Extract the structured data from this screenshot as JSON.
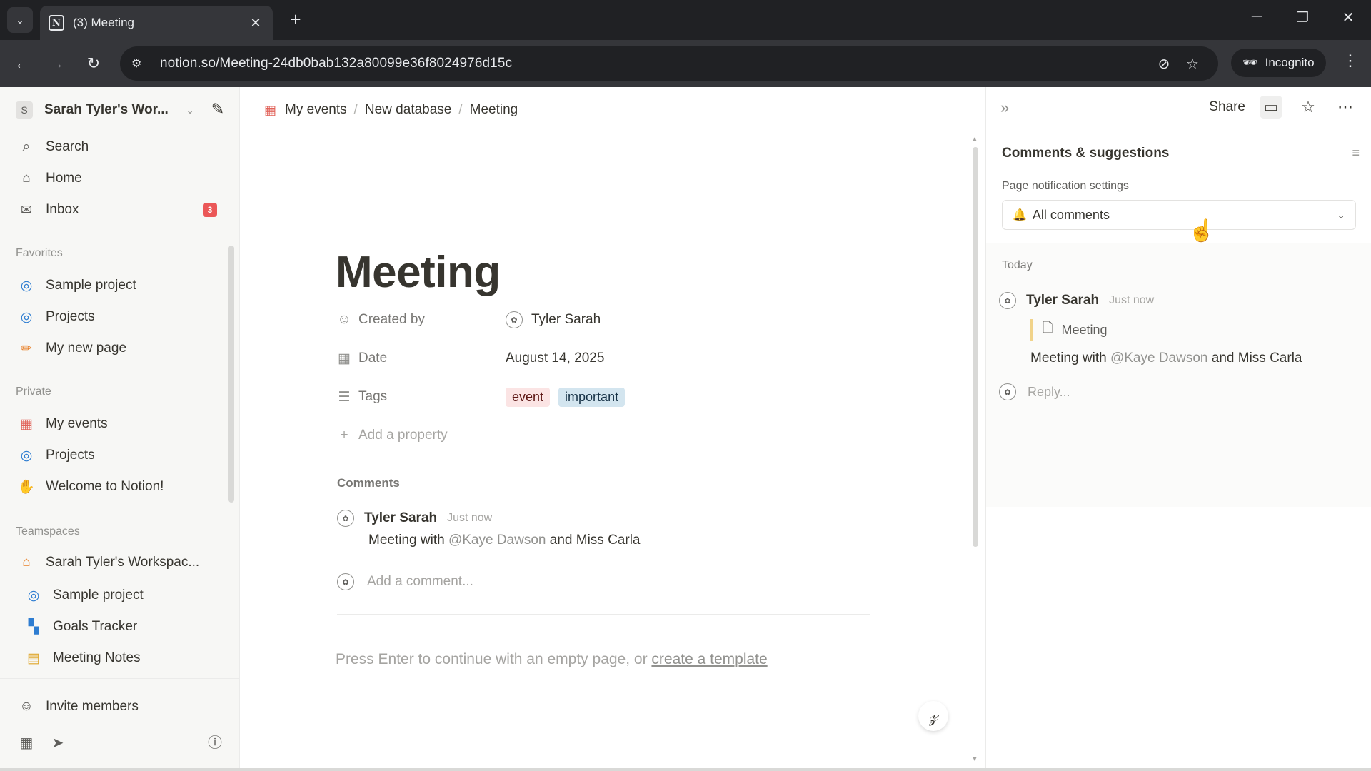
{
  "browser": {
    "tab_title": "(3) Meeting",
    "tab_favicon": "N",
    "url": "notion.so/Meeting-24db0bab132a80099e36f8024976d15c",
    "incognito_label": "Incognito"
  },
  "sidebar": {
    "workspace_initial": "S",
    "workspace_name": "Sarah Tyler's Wor...",
    "top_items": [
      {
        "label": "Search",
        "icon": "search-icon"
      },
      {
        "label": "Home",
        "icon": "home-icon"
      },
      {
        "label": "Inbox",
        "icon": "inbox-icon",
        "badge": "3"
      }
    ],
    "favorites_label": "Favorites",
    "favorites": [
      {
        "label": "Sample project",
        "icon": "project-icon"
      },
      {
        "label": "Projects",
        "icon": "project-icon"
      },
      {
        "label": "My new page",
        "icon": "pencil-icon"
      }
    ],
    "private_label": "Private",
    "private": [
      {
        "label": "My events",
        "icon": "calendar-icon"
      },
      {
        "label": "Projects",
        "icon": "project-icon"
      },
      {
        "label": "Welcome to Notion!",
        "icon": "wave-icon"
      }
    ],
    "teamspaces_label": "Teamspaces",
    "teamspace": {
      "label": "Sarah Tyler's Workspac...",
      "icon": "house-icon"
    },
    "teamspace_items": [
      {
        "label": "Sample project",
        "icon": "project-icon"
      },
      {
        "label": "Goals Tracker",
        "icon": "chart-icon"
      },
      {
        "label": "Meeting Notes",
        "icon": "calendar-icon"
      }
    ],
    "invite_label": "Invite members"
  },
  "breadcrumb": [
    "My events",
    "New database",
    "Meeting"
  ],
  "page": {
    "title": "Meeting",
    "properties": {
      "created_by": {
        "name": "Created by",
        "value": "Tyler Sarah"
      },
      "date": {
        "name": "Date",
        "value": "August 14, 2025"
      },
      "tags": {
        "name": "Tags",
        "values": [
          "event",
          "important"
        ]
      },
      "add_property": "Add a property"
    },
    "comments_label": "Comments",
    "comment": {
      "author": "Tyler Sarah",
      "time": "Just now",
      "body_prefix": "Meeting with",
      "mention": "@Kaye Dawson",
      "body_suffix": "and Miss Carla"
    },
    "add_comment_placeholder": "Add a comment...",
    "empty_hint_prefix": "Press Enter to continue with an empty page, or",
    "empty_hint_link": "create a template"
  },
  "right_panel": {
    "share_label": "Share",
    "title": "Comments & suggestions",
    "notification_label": "Page notification settings",
    "notification_value": "All comments",
    "day_label": "Today",
    "thread": {
      "author": "Tyler Sarah",
      "time": "Just now",
      "quote": "Meeting",
      "body_prefix": "Meeting with",
      "mention": "@Kaye Dawson",
      "body_suffix": "and Miss Carla"
    },
    "reply_placeholder": "Reply..."
  },
  "colors": {
    "accent_red": "#eb5757",
    "tag_event_bg": "#fbe4e4",
    "tag_important_bg": "#d3e5ef",
    "sidebar_bg": "#f7f7f5"
  }
}
